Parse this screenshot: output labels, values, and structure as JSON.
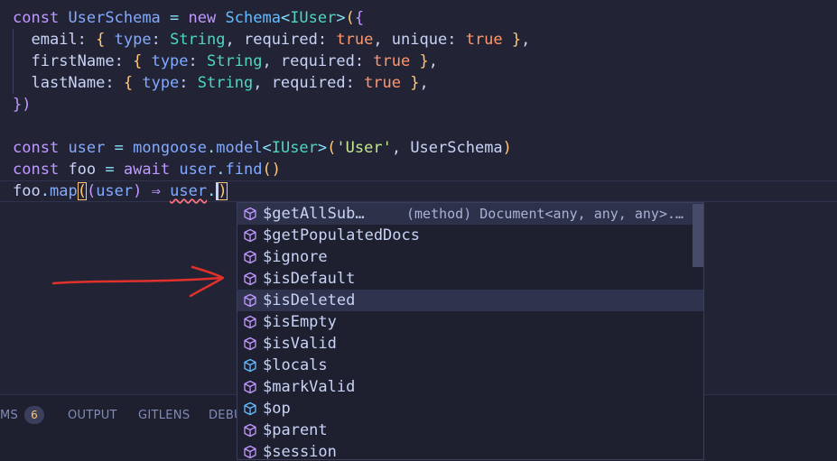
{
  "code": {
    "line1": [
      "const",
      "UserSchema",
      "=",
      "new",
      "Schema",
      "<",
      "IUser",
      ">",
      "(",
      "{"
    ],
    "line2": {
      "key": "email",
      "type_key": "type",
      "type_val": "String",
      "req_key": "required",
      "req_val": "true",
      "uniq_key": "unique",
      "uniq_val": "true"
    },
    "line3": {
      "key": "firstName",
      "type_key": "type",
      "type_val": "String",
      "req_key": "required",
      "req_val": "true"
    },
    "line4": {
      "key": "lastName",
      "type_key": "type",
      "type_val": "String",
      "req_key": "required",
      "req_val": "true"
    },
    "line5": "})",
    "line7": {
      "kw": "const",
      "name": "user",
      "eq": "=",
      "obj": "mongoose",
      "method": "model",
      "generic": "IUser",
      "arg": "'User'",
      "arg2": "UserSchema"
    },
    "line8": {
      "kw": "const",
      "name": "foo",
      "eq": "=",
      "await": "await",
      "obj": "user",
      "method": "find",
      "parens": "()"
    },
    "line9": {
      "obj": "foo",
      "method": "map",
      "param": "user",
      "arrow": "⇒",
      "access": "user",
      "dot": "."
    }
  },
  "suggestions": [
    {
      "label": "$getAllSub…",
      "detail": "(method) Document<any, any, any>.…",
      "icon": "method-cube-icon"
    },
    {
      "label": "$getPopulatedDocs",
      "icon": "method-cube-icon"
    },
    {
      "label": "$ignore",
      "icon": "method-cube-icon"
    },
    {
      "label": "$isDefault",
      "icon": "method-cube-icon"
    },
    {
      "label": "$isDeleted",
      "icon": "method-cube-icon"
    },
    {
      "label": "$isEmpty",
      "icon": "method-cube-icon"
    },
    {
      "label": "$isValid",
      "icon": "method-cube-icon"
    },
    {
      "label": "$locals",
      "icon": "field-cube-icon"
    },
    {
      "label": "$markValid",
      "icon": "method-cube-icon"
    },
    {
      "label": "$op",
      "icon": "field-cube-icon"
    },
    {
      "label": "$parent",
      "icon": "method-cube-icon"
    },
    {
      "label": "$session",
      "icon": "method-cube-icon"
    }
  ],
  "panel": {
    "tab_problems": "MS",
    "problems_count": "6",
    "tab_output": "OUTPUT",
    "tab_gitlens": "GITLENS",
    "tab_debug": "DEBU"
  },
  "colors": {
    "method_icon": "#c099ff",
    "field_icon": "#65bcff",
    "arrow": "#e0312b"
  }
}
